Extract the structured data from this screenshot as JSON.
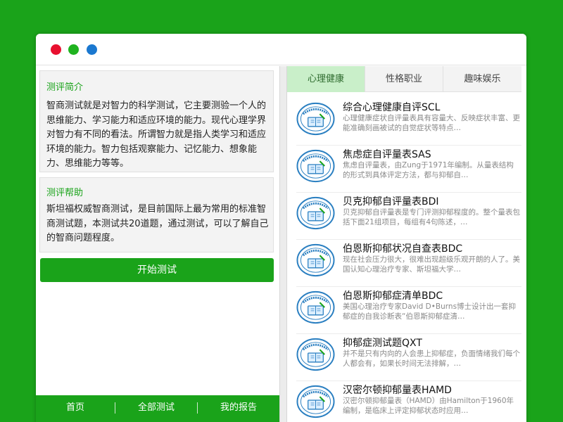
{
  "window": {
    "controls": {
      "close_color": "#e8102f",
      "minimize_color": "#1fb31f",
      "maximize_color": "#1a78d0"
    }
  },
  "intro": {
    "title": "测评简介",
    "text": "智商测试就是对智力的科学测试，它主要测验一个人的思维能力、学习能力和适应环境的能力。现代心理学界对智力有不同的看法。所谓智力就是指人类学习和适应环境的能力。智力包括观察能力、记忆能力、想象能力、思维能力等等。"
  },
  "help": {
    "title": "测评帮助",
    "text": "斯坦福权威智商测试，是目前国际上最为常用的标准智商测试题，本测试共20道题，通过测试，可以了解自己的智商问题程度。"
  },
  "start_button": "开始测试",
  "bottom_nav": [
    "首页",
    "全部测试",
    "我的报告"
  ],
  "tabs": [
    {
      "label": "心理健康",
      "active": true
    },
    {
      "label": "性格职业",
      "active": false
    },
    {
      "label": "趣味娱乐",
      "active": false
    }
  ],
  "list": [
    {
      "title": "综合心理健康自评SCL",
      "desc": "心理健康症状自评量表具有容量大、反映症状丰富、更能准确刻画被试的自觉症状等特点…",
      "icon": "psych-test-badge-icon"
    },
    {
      "title": "焦虑症自评量表SAS",
      "desc": "焦虑自评量表，由Zung于1971年编制。从量表结构的形式到具体评定方法，都与抑郁自…",
      "icon": "psych-test-badge-icon"
    },
    {
      "title": "贝克抑郁自评量表BDI",
      "desc": "贝克抑郁自评量表是专门评测抑郁程度的。整个量表包括下面21组项目，每组有4句陈述，…",
      "icon": "psych-test-badge-icon"
    },
    {
      "title": "伯恩斯抑郁状况自查表BDC",
      "desc": "现在社会压力很大，很难出现超级乐观开朗的人了。美国认知心理治疗专家、斯坦福大学…",
      "icon": "psych-test-badge-icon"
    },
    {
      "title": "伯恩斯抑郁症清单BDC",
      "desc": "美国心理治疗专家David D•Burns博士设计出一套抑郁症的自我诊断表“伯恩斯抑郁症清…",
      "icon": "psych-test-badge-icon"
    },
    {
      "title": "抑郁症测试题QXT",
      "desc": "并不是只有内向的人会患上抑郁症，负面情绪我们每个人都会有，如果长时间无法排解，…",
      "icon": "psych-test-badge-icon"
    },
    {
      "title": "汉密尔顿抑郁量表HAMD",
      "desc": "汉密尔顿抑郁量表（HAMD）由Hamilton于1960年编制，是临床上评定抑郁状态时应用…",
      "icon": "psych-test-badge-icon"
    }
  ]
}
